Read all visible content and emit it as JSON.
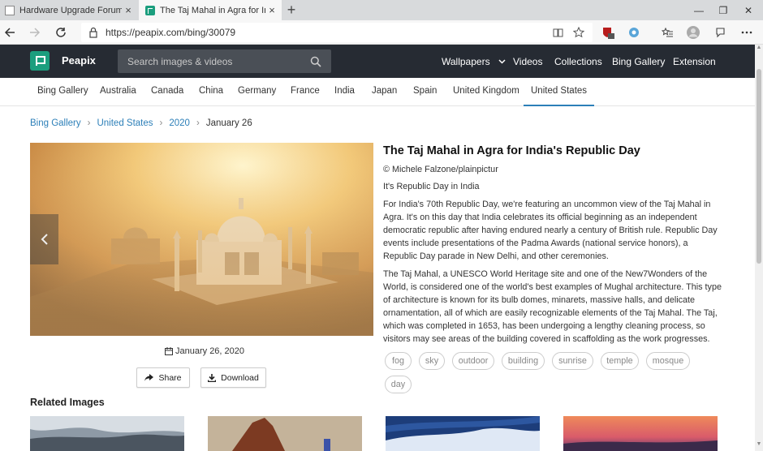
{
  "browser": {
    "tabs": [
      {
        "title": "Hardware Upgrade Forum - Repl",
        "active": false
      },
      {
        "title": "The Taj Mahal in Agra for India's",
        "active": true
      }
    ],
    "new_tab_symbol": "+",
    "close_symbol": "×",
    "window_controls": {
      "minimize": "—",
      "restore": "❐",
      "close": "✕"
    },
    "url": "https://peapix.com/bing/30079",
    "extension_badge": "1"
  },
  "site": {
    "brand": "Peapix",
    "search_placeholder": "Search images & videos",
    "nav": [
      {
        "label": "Wallpapers",
        "has_dropdown": true
      },
      {
        "label": "Videos"
      },
      {
        "label": "Collections"
      },
      {
        "label": "Bing Gallery"
      },
      {
        "label": "Extension"
      }
    ]
  },
  "countries": {
    "items": [
      "Bing Gallery",
      "Australia",
      "Canada",
      "China",
      "Germany",
      "France",
      "India",
      "Japan",
      "Spain",
      "United Kingdom",
      "United States"
    ],
    "active": "United States"
  },
  "breadcrumb": {
    "links": [
      "Bing Gallery",
      "United States",
      "2020"
    ],
    "current": "January 26",
    "separator": "›"
  },
  "photo": {
    "date": "January 26, 2020",
    "share_label": "Share",
    "download_label": "Download"
  },
  "article": {
    "title": "The Taj Mahal in Agra for India's Republic Day",
    "credit": "© Michele Falzone/plainpictur",
    "subtitle": "It's Republic Day in India",
    "paragraph1": "For India's 70th Republic Day, we're featuring an uncommon view of the Taj Mahal in Agra. It's on this day that India celebrates its official beginning as an independent democratic republic after having endured nearly a century of British rule. Republic Day events include presentations of the Padma Awards (national service honors), a Republic Day parade in New Delhi, and other ceremonies.",
    "paragraph2": "The Taj Mahal, a UNESCO World Heritage site and one of the New7Wonders of the World, is considered one of the world's best examples of Mughal architecture. This type of architecture is known for its bulb domes, minarets, massive halls, and delicate ornamentation, all of which are easily recognizable elements of the Taj Mahal. The Taj, which was completed in 1653, has been undergoing a lengthy cleaning process, so visitors may see areas of the building covered in scaffolding as the work progresses."
  },
  "tags": [
    "fog",
    "sky",
    "outdoor",
    "building",
    "sunrise",
    "temple",
    "mosque",
    "day"
  ],
  "related": {
    "title": "Related Images"
  },
  "colors": {
    "header_bg": "#262b33",
    "brand_green": "#1b9e7e",
    "link_blue": "#2c7fb8"
  }
}
